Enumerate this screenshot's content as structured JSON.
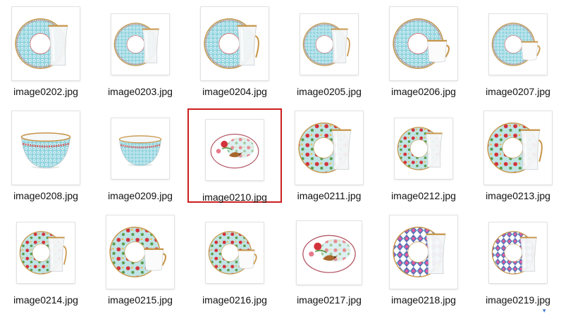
{
  "window": {
    "view": "Large icons"
  },
  "files": [
    {
      "name": "image0202.jpg",
      "kind": "saucer-glass",
      "theme": "blue",
      "size": "big",
      "selected": false
    },
    {
      "name": "image0203.jpg",
      "kind": "saucer-glass",
      "theme": "blue",
      "size": "mid",
      "selected": false
    },
    {
      "name": "image0204.jpg",
      "kind": "saucer-glass-handle",
      "theme": "blue",
      "size": "big",
      "selected": false
    },
    {
      "name": "image0205.jpg",
      "kind": "saucer-glass-handle",
      "theme": "blue",
      "size": "mid",
      "selected": false
    },
    {
      "name": "image0206.jpg",
      "kind": "saucer-cup",
      "theme": "blue",
      "size": "big",
      "selected": false
    },
    {
      "name": "image0207.jpg",
      "kind": "saucer-cup",
      "theme": "blue",
      "size": "mid",
      "selected": false
    },
    {
      "name": "image0208.jpg",
      "kind": "bowl",
      "theme": "blue",
      "size": "big",
      "selected": false
    },
    {
      "name": "image0209.jpg",
      "kind": "bowl",
      "theme": "blue",
      "size": "mid",
      "selected": false
    },
    {
      "name": "image0210.jpg",
      "kind": "oval-bird",
      "theme": "floral",
      "size": "mid",
      "selected": true
    },
    {
      "name": "image0211.jpg",
      "kind": "saucer-glass",
      "theme": "floral",
      "size": "big",
      "selected": false
    },
    {
      "name": "image0212.jpg",
      "kind": "saucer-glass",
      "theme": "floral",
      "size": "mid",
      "selected": false
    },
    {
      "name": "image0213.jpg",
      "kind": "saucer-glass-handle",
      "theme": "floral",
      "size": "big",
      "selected": false
    },
    {
      "name": "image0214.jpg",
      "kind": "saucer-glass-handle",
      "theme": "floral",
      "size": "mid",
      "selected": false
    },
    {
      "name": "image0215.jpg",
      "kind": "saucer-cup",
      "theme": "floral",
      "size": "big",
      "selected": false
    },
    {
      "name": "image0216.jpg",
      "kind": "saucer-cup",
      "theme": "floral",
      "size": "mid",
      "selected": false
    },
    {
      "name": "image0217.jpg",
      "kind": "oval-bird",
      "theme": "floral",
      "size": "small",
      "selected": false
    },
    {
      "name": "image0218.jpg",
      "kind": "saucer-glass",
      "theme": "ikat",
      "size": "big",
      "selected": false
    },
    {
      "name": "image0219.jpg",
      "kind": "saucer-glass",
      "theme": "ikat",
      "size": "mid",
      "selected": false
    }
  ],
  "colors": {
    "selection_border": "#cc1f1f",
    "blue_pattern": "#8fd3de",
    "blue_dots": "#d85a5a",
    "gold_rim": "#c8964a",
    "floral_base": "#bfe4e4",
    "floral_red": "#d2323c",
    "floral_green": "#5a9a4a",
    "ikat_blue": "#3554a8",
    "ikat_pink": "#e85aa0",
    "ikat_teal": "#3fb6c8",
    "glass": "#f4f6f7"
  }
}
